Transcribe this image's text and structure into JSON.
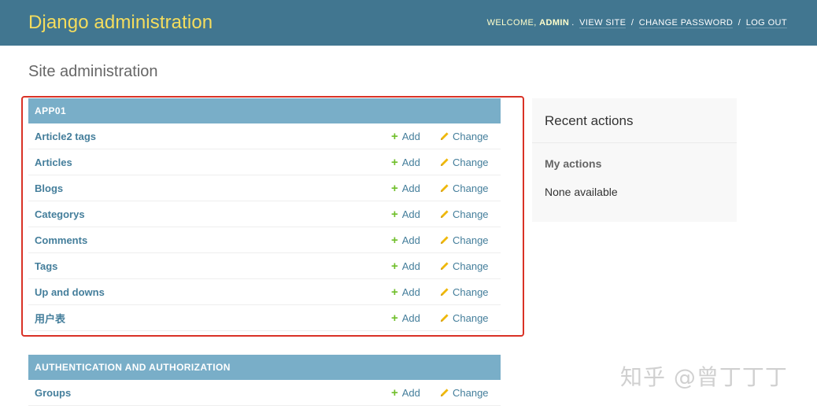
{
  "header": {
    "branding": "Django administration",
    "welcome": "Welcome,",
    "username": "admin",
    "view_site": "View site",
    "change_password": "Change password",
    "log_out": "Log out",
    "separator": "/"
  },
  "page_title": "Site administration",
  "apps": [
    {
      "name": "APP01",
      "models": [
        {
          "name": "Article2 tags",
          "add": "Add",
          "change": "Change"
        },
        {
          "name": "Articles",
          "add": "Add",
          "change": "Change"
        },
        {
          "name": "Blogs",
          "add": "Add",
          "change": "Change"
        },
        {
          "name": "Categorys",
          "add": "Add",
          "change": "Change"
        },
        {
          "name": "Comments",
          "add": "Add",
          "change": "Change"
        },
        {
          "name": "Tags",
          "add": "Add",
          "change": "Change"
        },
        {
          "name": "Up and downs",
          "add": "Add",
          "change": "Change"
        },
        {
          "name": "用户表",
          "add": "Add",
          "change": "Change"
        }
      ]
    },
    {
      "name": "AUTHENTICATION AND AUTHORIZATION",
      "models": [
        {
          "name": "Groups",
          "add": "Add",
          "change": "Change"
        }
      ]
    }
  ],
  "recent_actions": {
    "title": "Recent actions",
    "my_actions": "My actions",
    "empty": "None available"
  },
  "watermark": "知乎 @曾丁丁丁",
  "colors": {
    "header_bg": "#417690",
    "branding": "#f5dd5d",
    "module_caption": "#79aec8",
    "link": "#447e9b",
    "add_icon": "#70bf2b",
    "change_icon": "#efb80b",
    "highlight": "#d93226"
  }
}
